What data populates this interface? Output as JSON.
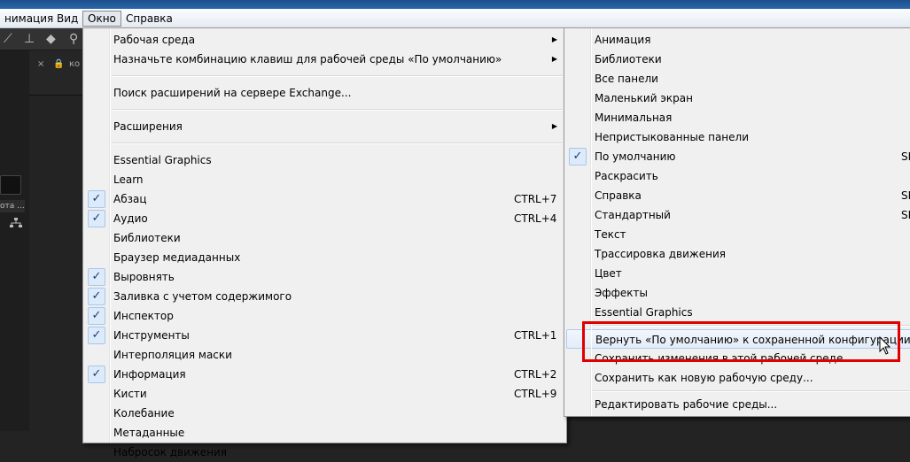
{
  "menubar": {
    "items": [
      "нимация",
      "Вид",
      "Окно",
      "Справка"
    ],
    "open_index": 2
  },
  "panel": {
    "tab_close": "×",
    "tab_text": "ко",
    "label": "ота ..."
  },
  "window_menu": {
    "items": [
      {
        "label": "Рабочая среда",
        "submenu": true
      },
      {
        "label": "Назначьте комбинацию клавиш для рабочей среды «По умолчанию»",
        "submenu": true
      },
      {
        "separator": true
      },
      {
        "label": "Поиск расширений на сервере Exchange..."
      },
      {
        "separator": true
      },
      {
        "label": "Расширения",
        "submenu": true
      },
      {
        "separator": true
      },
      {
        "label": "Essential Graphics"
      },
      {
        "label": "Learn"
      },
      {
        "label": "Абзац",
        "checked": true,
        "shortcut": "CTRL+7"
      },
      {
        "label": "Аудио",
        "checked": true,
        "shortcut": "CTRL+4"
      },
      {
        "label": "Библиотеки"
      },
      {
        "label": "Браузер медиаданных"
      },
      {
        "label": "Выровнять",
        "checked": true
      },
      {
        "label": "Заливка с учетом содержимого",
        "checked": true
      },
      {
        "label": "Инспектор",
        "checked": true
      },
      {
        "label": "Инструменты",
        "checked": true,
        "shortcut": "CTRL+1"
      },
      {
        "label": "Интерполяция маски"
      },
      {
        "label": "Информация",
        "checked": true,
        "shortcut": "CTRL+2"
      },
      {
        "label": "Кисти",
        "shortcut": "CTRL+9"
      },
      {
        "label": "Колебание"
      },
      {
        "label": "Метаданные"
      },
      {
        "label": "Набросок движения"
      }
    ]
  },
  "workspace_menu": {
    "items": [
      {
        "label": "Анимация"
      },
      {
        "label": "Библиотеки"
      },
      {
        "label": "Все панели"
      },
      {
        "label": "Маленький экран"
      },
      {
        "label": "Минимальная"
      },
      {
        "label": "Непристыкованные панели"
      },
      {
        "label": "По умолчанию",
        "checked": true,
        "shortcut": "SH"
      },
      {
        "label": "Раскрасить"
      },
      {
        "label": "Справка",
        "shortcut": "SH"
      },
      {
        "label": "Стандартный",
        "shortcut": "SH"
      },
      {
        "label": "Текст"
      },
      {
        "label": "Трассировка движения"
      },
      {
        "label": "Цвет"
      },
      {
        "label": "Эффекты"
      },
      {
        "label": "Essential Graphics"
      },
      {
        "separator": true
      },
      {
        "label": "Вернуть «По умолчанию» к сохраненной конфигурации",
        "highlighted": true
      },
      {
        "label": "Сохранить изменения в этой рабочей среде"
      },
      {
        "label": "Сохранить как новую рабочую среду..."
      },
      {
        "separator": true
      },
      {
        "label": "Редактировать рабочие среды..."
      }
    ]
  },
  "colors": {
    "annotation_box": "#e00000",
    "menu_bg": "#f0f0f0",
    "check_bg": "#dceaf9",
    "highlight_border": "#aecbf0"
  },
  "icons": {
    "check": "check-icon",
    "submenu_arrow": "submenu-arrow-icon",
    "cursor": "mouse-cursor-icon"
  }
}
